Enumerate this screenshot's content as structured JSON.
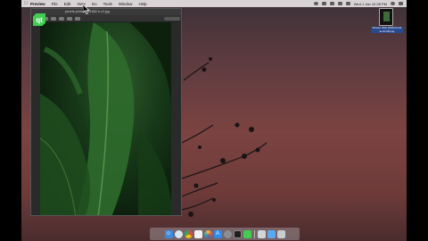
{
  "menubar": {
    "apple": "",
    "app_name": "Preview",
    "items": [
      "File",
      "Edit",
      "View",
      "Go",
      "Tools",
      "Window",
      "Help"
    ],
    "clock": "Wed 1 Jan  10:28 PM"
  },
  "preview_window": {
    "filename": "pexels-photo-1001682-b-v2.jpg"
  },
  "qt_logo": {
    "text": "qt"
  },
  "desktop_icon": {
    "label": "Screen Shot 2020-01-01 at 10.28.png"
  },
  "dock": {
    "apps": [
      "finder-icon",
      "safari-icon",
      "chrome-icon",
      "calendar-icon",
      "photos-icon",
      "appstore-icon",
      "preferences-icon",
      "terminal-icon",
      "qt-creator-icon",
      "preview-icon",
      "folder-icon",
      "trash-icon"
    ]
  },
  "colors": {
    "qt_green": "#41cd52",
    "wallpaper_top": "#3c3138",
    "wallpaper_mid": "#7b4341"
  }
}
